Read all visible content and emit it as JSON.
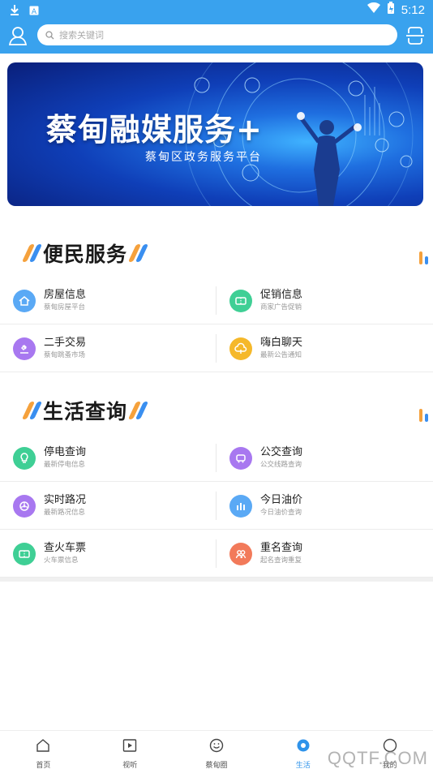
{
  "status_bar": {
    "time": "5:12"
  },
  "header": {
    "search_placeholder": "搜索关键词"
  },
  "banner": {
    "title": "蔡甸融媒服务+",
    "subtitle": "蔡甸区政务服务平台"
  },
  "sections": [
    {
      "title": "便民服务",
      "items": [
        {
          "title": "房屋信息",
          "subtitle": "蔡甸房屋平台",
          "icon": "house-icon",
          "color": "#5aa9f5"
        },
        {
          "title": "促销信息",
          "subtitle": "商家广告促销",
          "icon": "ticket-icon",
          "color": "#3fcf95"
        },
        {
          "title": "二手交易",
          "subtitle": "蔡甸跳蚤市场",
          "icon": "gavel-icon",
          "color": "#a878f0"
        },
        {
          "title": "嗨白聊天",
          "subtitle": "最新公告通知",
          "icon": "cloud-icon",
          "color": "#f5b82a"
        }
      ]
    },
    {
      "title": "生活查询",
      "items": [
        {
          "title": "停电查询",
          "subtitle": "最新停电信息",
          "icon": "bulb-icon",
          "color": "#3fcf95"
        },
        {
          "title": "公交查询",
          "subtitle": "公交线路查询",
          "icon": "bus-icon",
          "color": "#a878f0"
        },
        {
          "title": "实时路况",
          "subtitle": "最新路况信息",
          "icon": "wheel-icon",
          "color": "#a878f0"
        },
        {
          "title": "今日油价",
          "subtitle": "今日油价查询",
          "icon": "bars-icon",
          "color": "#5aa9f5"
        },
        {
          "title": "查火车票",
          "subtitle": "火车票信息",
          "icon": "ticket-icon",
          "color": "#3fcf95"
        },
        {
          "title": "重名查询",
          "subtitle": "起名查询重复",
          "icon": "people-icon",
          "color": "#f27a5a"
        }
      ]
    }
  ],
  "bottom_nav": [
    {
      "label": "首页",
      "icon": "home-icon"
    },
    {
      "label": "视听",
      "icon": "play-icon"
    },
    {
      "label": "蔡甸圈",
      "icon": "smile-icon"
    },
    {
      "label": "生活",
      "icon": "life-icon",
      "active": true
    },
    {
      "label": "我的",
      "icon": "profile-icon"
    }
  ],
  "watermark": "QQTF.COM",
  "colors": {
    "primary": "#39a2ee",
    "accent_orange": "#f5a13c",
    "accent_blue": "#3a8ff0"
  }
}
